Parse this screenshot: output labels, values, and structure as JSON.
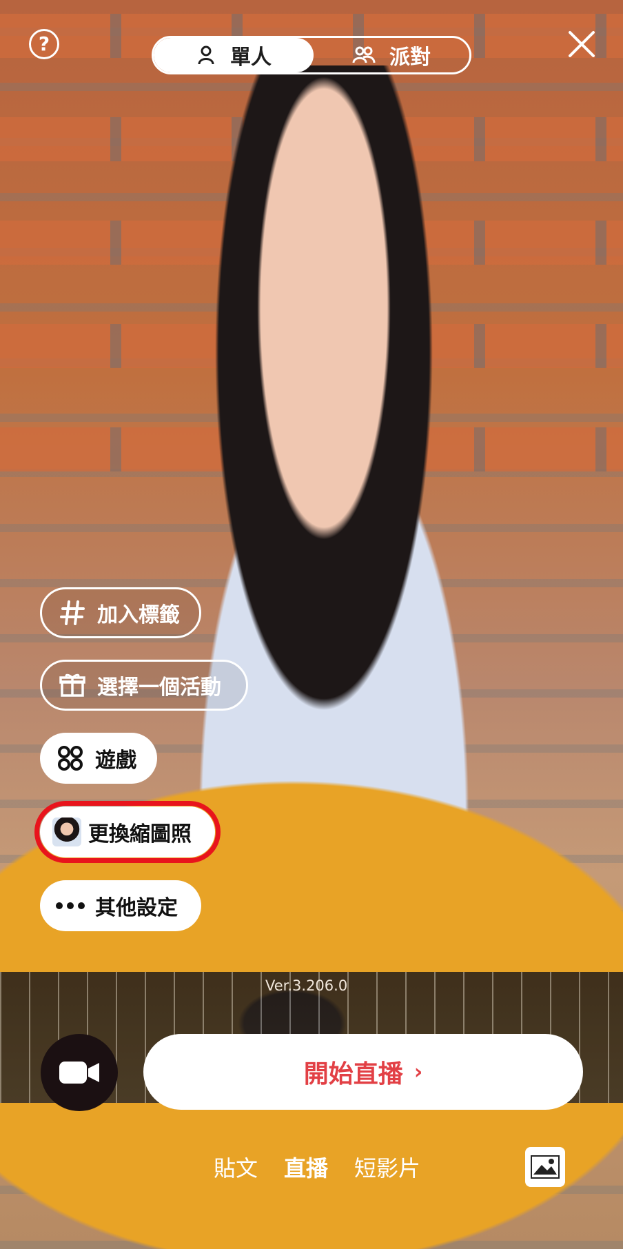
{
  "header": {
    "help_icon": "question-circle-icon",
    "close_icon": "close-icon",
    "modes": [
      {
        "label": "單人",
        "icon": "person-icon",
        "active": true
      },
      {
        "label": "派對",
        "icon": "group-icon",
        "active": false
      }
    ]
  },
  "menu": [
    {
      "label": "加入標籤",
      "icon": "hash-icon",
      "style": "outline"
    },
    {
      "label": "選擇一個活動",
      "icon": "gift-icon",
      "style": "outline"
    },
    {
      "label": "遊戲",
      "icon": "grid-icon",
      "style": "white"
    },
    {
      "label": "更換縮圖照",
      "icon": "thumbnail-image",
      "style": "white",
      "highlighted": true
    },
    {
      "label": "其他設定",
      "icon": "more-dots-icon",
      "style": "white"
    }
  ],
  "version": "Ver.3.206.0",
  "bottom": {
    "camera_icon": "video-camera-icon",
    "start_label": "開始直播",
    "tabs": [
      {
        "label": "貼文",
        "active": false
      },
      {
        "label": "直播",
        "active": true
      },
      {
        "label": "短影片",
        "active": false
      }
    ],
    "gallery_icon": "gallery-image-icon"
  },
  "colors": {
    "accent_red": "#e8141c",
    "start_text": "#e24045"
  }
}
